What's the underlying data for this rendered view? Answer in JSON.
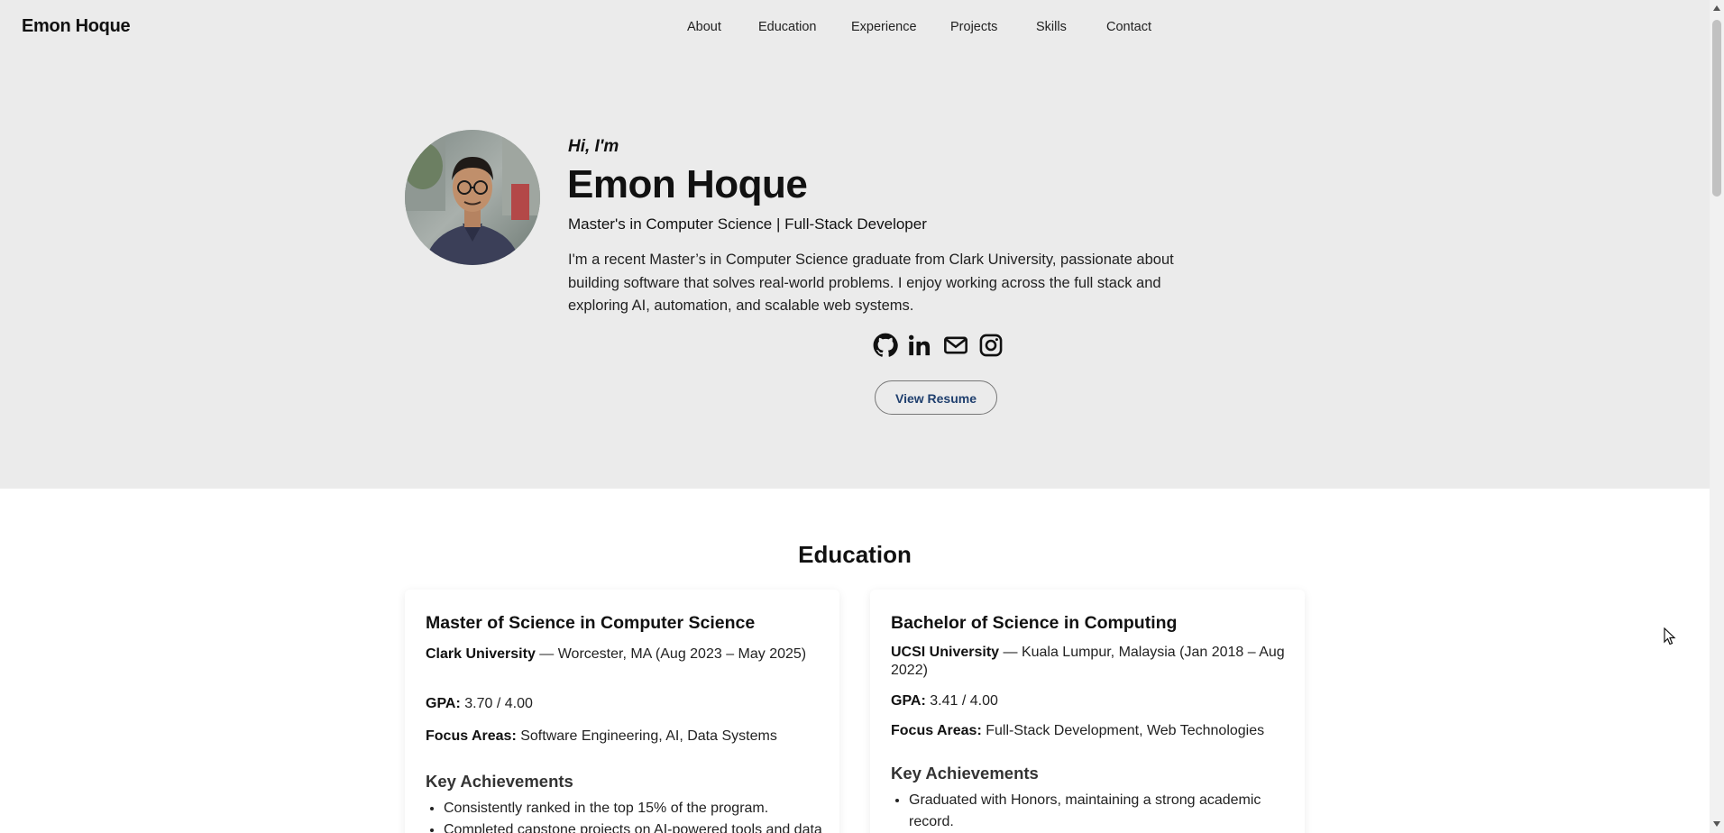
{
  "nav": {
    "brand": "Emon Hoque",
    "links": [
      {
        "label": "About"
      },
      {
        "label": "Education"
      },
      {
        "label": "Experience"
      },
      {
        "label": "Projects"
      },
      {
        "label": "Skills"
      },
      {
        "label": "Contact"
      }
    ]
  },
  "hero": {
    "greeting": "Hi, I'm",
    "name": "Emon Hoque",
    "subtitle": "Master's in Computer Science | Full-Stack Developer",
    "bio": "I'm a recent Master’s in Computer Science graduate from Clark University, passionate about building software that solves real-world problems. I enjoy working across the full stack and exploring AI, automation, and scalable web systems.",
    "socials": [
      {
        "icon": "github-icon"
      },
      {
        "icon": "linkedin-icon"
      },
      {
        "icon": "mail-icon"
      },
      {
        "icon": "instagram-icon"
      }
    ],
    "resume_button": "View Resume"
  },
  "education": {
    "title": "Education",
    "cards": [
      {
        "degree": "Master of Science in Computer Science",
        "school": "Clark University",
        "details": " — Worcester, MA (Aug 2023 – May 2025)",
        "gpa_label": "GPA:",
        "gpa": " 3.70 / 4.00",
        "focus_label": "Focus Areas:",
        "focus": " Software Engineering, AI, Data Systems",
        "achievements_title": "Key Achievements",
        "achievements": [
          "Consistently ranked in the top 15% of the program.",
          "Completed capstone projects on AI-powered tools and data systems."
        ]
      },
      {
        "degree": "Bachelor of Science in Computing",
        "school": "UCSI University",
        "details": " — Kuala Lumpur, Malaysia (Jan 2018 – Aug 2022)",
        "gpa_label": "GPA:",
        "gpa": " 3.41 / 4.00",
        "focus_label": "Focus Areas:",
        "focus": " Full-Stack Development, Web Technologies",
        "achievements_title": "Key Achievements",
        "achievements": [
          "Graduated with Honors, maintaining a strong academic record."
        ]
      }
    ]
  },
  "colors": {
    "hero_bg": "#ebebeb",
    "accent_button_text": "#1f3f6e"
  }
}
